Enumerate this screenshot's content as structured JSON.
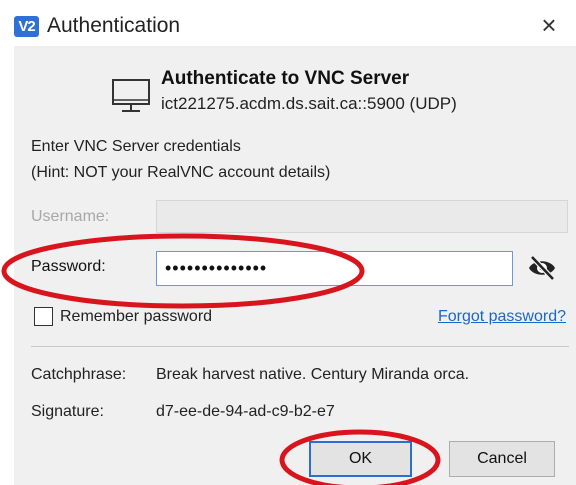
{
  "window": {
    "app_icon_text": "V2",
    "title": "Authentication",
    "close_glyph": "×"
  },
  "server": {
    "heading": "Authenticate to VNC Server",
    "address": "ict221275.acdm.ds.sait.ca::5900 (UDP)",
    "icon": "monitor-icon"
  },
  "instructions": {
    "line1": "Enter VNC Server credentials",
    "line2": "(Hint: NOT your RealVNC account details)"
  },
  "form": {
    "username_label": "Username:",
    "username_value": "",
    "password_label": "Password:",
    "password_value": "••••••••••••••",
    "reveal_icon": "eye-slash-icon",
    "remember_label": "Remember password",
    "remember_checked": false,
    "forgot_link": "Forgot password?"
  },
  "info": {
    "catchphrase_label": "Catchphrase:",
    "catchphrase_value": "Break harvest native. Century Miranda orca.",
    "signature_label": "Signature:",
    "signature_value": "d7-ee-de-94-ad-c9-b2-e7"
  },
  "buttons": {
    "ok": "OK",
    "cancel": "Cancel"
  },
  "colors": {
    "annotation_red": "#d8141c",
    "link_blue": "#1a66cc",
    "focus_blue": "#2a6fd3"
  }
}
